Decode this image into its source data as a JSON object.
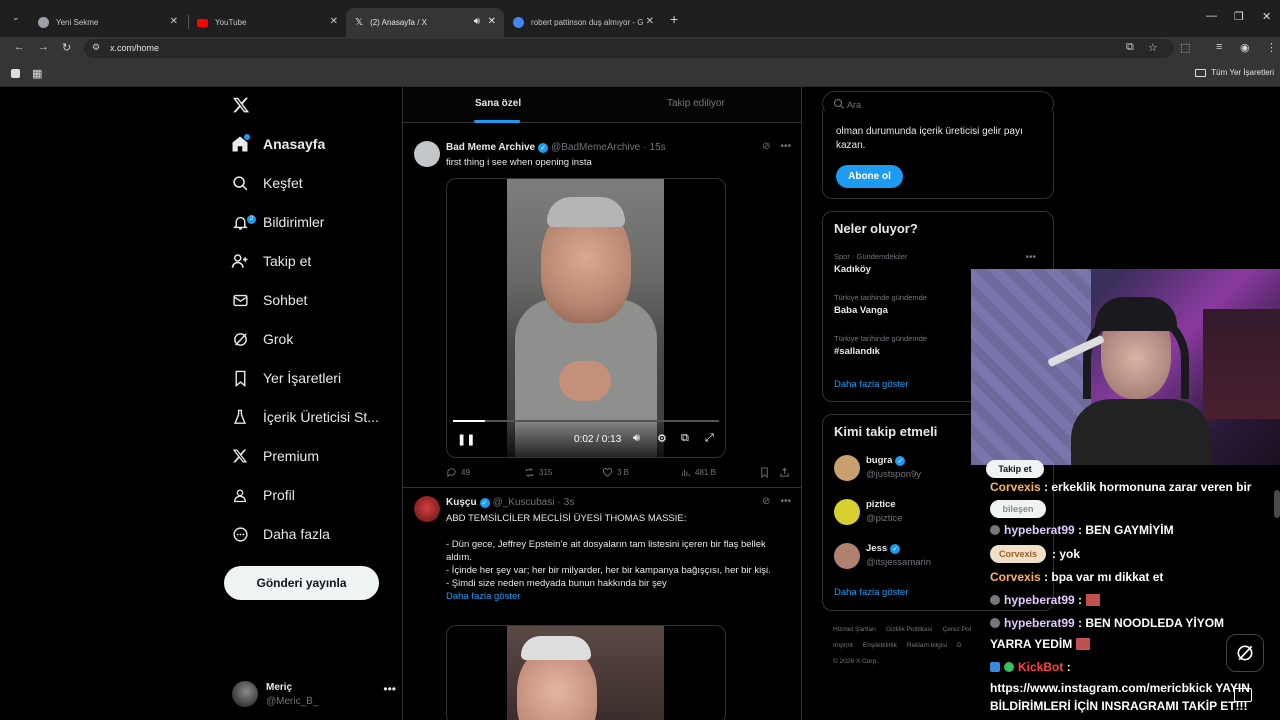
{
  "browser": {
    "tabs": [
      {
        "label": "Yeni Sekme",
        "favicon_color": "#9aa0a6"
      },
      {
        "label": "YouTube",
        "favicon_color": "#ff0000"
      },
      {
        "label": "(2) Anasayfa / X",
        "favicon_color": "#e3e3e3"
      },
      {
        "label": "robert pattinson duş almıyor - G",
        "favicon_color": "#4285f4"
      }
    ],
    "url": "x.com/home",
    "bookmarks_folder": "Tüm Yer İşaretleri"
  },
  "sidebar": {
    "items": [
      {
        "label": "Anasayfa",
        "icon": "home-icon",
        "active": true
      },
      {
        "label": "Keşfet",
        "icon": "search-icon"
      },
      {
        "label": "Bildirimler",
        "icon": "bell-icon",
        "badge": "2"
      },
      {
        "label": "Takip et",
        "icon": "follow-icon"
      },
      {
        "label": "Sohbet",
        "icon": "mail-icon"
      },
      {
        "label": "Grok",
        "icon": "grok-icon"
      },
      {
        "label": "Yer İşaretleri",
        "icon": "bookmark-icon"
      },
      {
        "label": "İçerik Üreticisi St...",
        "icon": "creator-icon"
      },
      {
        "label": "Premium",
        "icon": "x-icon"
      },
      {
        "label": "Profil",
        "icon": "person-icon"
      },
      {
        "label": "Daha fazla",
        "icon": "more-circle-icon"
      }
    ],
    "post_button": "Gönderi yayınla",
    "user": {
      "name": "Meriç",
      "handle": "@Meric_B_"
    }
  },
  "feed": {
    "tabs": [
      {
        "label": "Sana özel",
        "active": true
      },
      {
        "label": "Takip ediliyor",
        "active": false
      }
    ],
    "tweets": [
      {
        "name": "Bad Meme Archive",
        "handle": "@BadMemeArchive",
        "time": "15s",
        "text": "first thing i see when opening insta",
        "video": {
          "time": "0:02 / 0:13",
          "progress": 0.12
        },
        "stats": {
          "replies": "49",
          "reposts": "315",
          "likes": "3 B",
          "views": "481 B"
        }
      },
      {
        "name": "Kuşçu",
        "handle": "@_Kuscubasi",
        "time": "3s",
        "text_lines": [
          "ABD TEMSİLCİLER MECLİSİ ÜYESİ THOMAS MASSIE:",
          "",
          "- Dün gece, Jeffrey Epstein’e ait dosyaların tam listesini içeren bir flaş bellek aldım.",
          "- İçinde her şey var; her bir milyarder, her bir kampanya bağışçısı, her bir kişi.",
          "- Şimdi size neden medyada bunun hakkında bir şey"
        ],
        "show_more": "Daha fazla göster"
      }
    ]
  },
  "right": {
    "search_placeholder": "Ara",
    "premium_text": "olman durumunda içerik üreticisi gelir payı kazan.",
    "premium_button": "Abone ol",
    "trends_title": "Neler oluyor?",
    "trends": [
      {
        "category": "Spor · Gündemdekiler",
        "name": "Kadıköy"
      },
      {
        "category": "Türkiye tarihinde gündemde",
        "name": "Baba Vanga"
      },
      {
        "category": "Türkiye tarihinde gündemde",
        "name": "#sallandık"
      }
    ],
    "trends_more": "Daha fazla göster",
    "wtf_title": "Kimi takip etmeli",
    "wtf": [
      {
        "name": "bugra",
        "handle": "@justspon9y",
        "verified": true,
        "avatar": "#c8a070"
      },
      {
        "name": "piztice",
        "handle": "@piztice",
        "verified": false,
        "avatar": "#d8d030"
      },
      {
        "name": "Jess",
        "handle": "@itsjessamarin",
        "verified": true,
        "avatar": "#b08070"
      }
    ],
    "wtf_more": "Daha fazla göster",
    "footer": [
      "Hizmet Şartları",
      "Gizlilik Politikası",
      "Çerez Pol",
      "Imprint",
      "Erişilebilirlik",
      "Reklam bilgisi",
      "D",
      "© 2026 X Corp."
    ]
  },
  "overlay": {
    "follow_pill": "Takip et",
    "chat": [
      {
        "user": "Corvexis",
        "text": ": erkeklik hormonuna zarar veren bir"
      },
      {
        "user": "bileşen",
        "text": "",
        "pill": true
      },
      {
        "user": "hypeberat99",
        "text": ": BEN GAYMİYİM"
      },
      {
        "user": "Corvexis",
        "text": ": yok",
        "pill": true
      },
      {
        "user": "Corvexis",
        "text": ": bpa var mı dikkat et"
      },
      {
        "user": "hypeberat99",
        "text": ":"
      },
      {
        "user": "hypeberat99",
        "text": ": BEN NOODLEDA YİYOM"
      },
      {
        "user": "",
        "text": "YARRA YEDİM"
      },
      {
        "user": "KickBot",
        "text": ":"
      },
      {
        "user": "",
        "text": "https://www.instagram.com/mericbkick YAYIN"
      },
      {
        "user": "",
        "text": "BİLDİRİMLERİ İÇİN INSRAGRAMI TAKİP ET!!!"
      }
    ]
  }
}
